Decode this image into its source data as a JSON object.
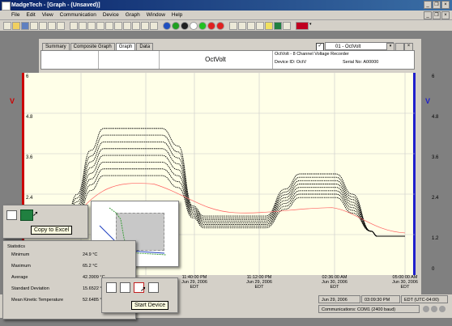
{
  "window": {
    "title": "MadgeTech - [Graph - (Unsaved)]",
    "controls": [
      "_",
      "❐",
      "×"
    ]
  },
  "menu": [
    "File",
    "Edit",
    "View",
    "Communication",
    "Device",
    "Graph",
    "Window",
    "Help"
  ],
  "tabs": [
    "Summary",
    "Composite Graph",
    "Graph",
    "Data"
  ],
  "channel_select": "01 - OctVolt",
  "graph_title": "OctVolt",
  "device_info": {
    "line1": "OctVolt - 8 Channel Voltage Recorder",
    "device_id": "Device ID: OctV",
    "serial": "Serial No: A00000"
  },
  "axis_unit_left": "V",
  "axis_unit_right": "V",
  "chart_data": {
    "type": "line",
    "y_ticks_left": [
      "6",
      "4.8",
      "3.6",
      "2.4"
    ],
    "y_ticks_right": [
      "6",
      "4.8",
      "3.6",
      "2.4",
      "1.2",
      "0"
    ],
    "x_ticks": [
      {
        "time": "11:40:00 PM",
        "date": "Jun 29, 2006",
        "tz": "EDT"
      },
      {
        "time": "11:12:00 PM",
        "date": "Jun 29, 2006",
        "tz": "EDT"
      },
      {
        "time": "02:36:00 AM",
        "date": "Jun 30, 2006",
        "tz": "EDT"
      },
      {
        "time": "05:00:00 AM",
        "date": "Jun 30, 2006",
        "tz": "EDT"
      }
    ],
    "ylim": [
      0,
      6
    ],
    "grid": true,
    "series_peaks": [
      4.35,
      4.15,
      3.95,
      3.75,
      3.55,
      3.35,
      3.15,
      2.95
    ],
    "series_mid": [
      1.75,
      1.7,
      1.65,
      1.6,
      1.55,
      1.5,
      1.45,
      1.4
    ],
    "series_second_peak": [
      3.0,
      2.9,
      2.8,
      2.7,
      2.6,
      2.5,
      2.4,
      2.3
    ],
    "colors": {
      "series": "#000000",
      "red_trace": "#ff6060",
      "left_axis": "#cc0000",
      "right_axis": "#2020cc"
    }
  },
  "copy_popup": {
    "label": "Copy to Excel"
  },
  "statistics": {
    "title": "Statistics",
    "rows": [
      {
        "label": "Minimum",
        "value": "24.9 °C"
      },
      {
        "label": "Maximum",
        "value": "65.2 °C"
      },
      {
        "label": "Average",
        "value": "42.3909 °C"
      },
      {
        "label": "Standard Deviation",
        "value": "15.6522 °C"
      },
      {
        "label": "Mean Kinetic Temperature",
        "value": "52.6485 °C"
      }
    ]
  },
  "start_popup": {
    "label": "Start Device"
  },
  "status": {
    "date": "Jun 29, 2006",
    "time": "03:09:30 PM",
    "tz": "EDT (UTC-04:00)",
    "comm": "Communications: COM1 (2400 baud)"
  }
}
